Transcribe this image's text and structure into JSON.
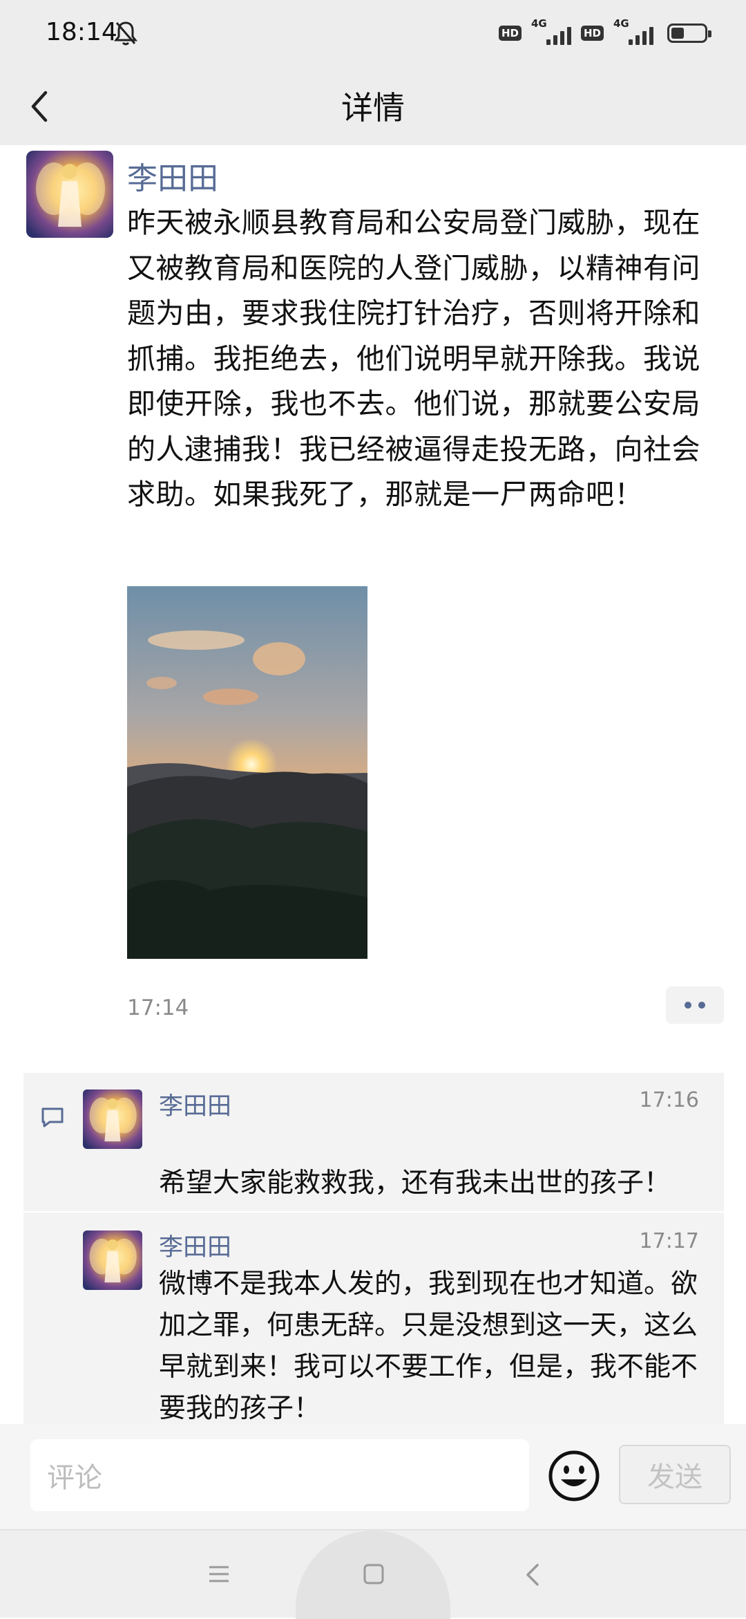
{
  "status_bar": {
    "time": "18:14",
    "hd_label": "HD",
    "network_label": "4G"
  },
  "nav": {
    "title": "详情"
  },
  "post": {
    "author": "李田田",
    "text": "昨天被永顺县教育局和公安局登门威胁，现在又被教育局和医院的人登门威胁，以精神有问题为由，要求我住院打针治疗，否则将开除和抓捕。我拒绝去，他们说明早就开除我。我说即使开除，我也不去。他们说，那就要公安局的人逮捕我！我已经被逼得走投无路，向社会求助。如果我死了，那就是一尸两命吧！",
    "time": "17:14"
  },
  "comments": [
    {
      "author": "李田田",
      "time": "17:16",
      "text": "希望大家能救救我，还有我未出世的孩子！"
    },
    {
      "author": "李田田",
      "time": "17:17",
      "text": "微博不是我本人发的，我到现在也才知道。欲加之罪，何患无辞。只是没想到这一天，这么早就到来！我可以不要工作，但是，我不能不要我的孩子！"
    }
  ],
  "input": {
    "placeholder": "评论",
    "send_label": "发送"
  },
  "icons": {
    "bell": "bell-off-icon",
    "back": "chevron-left-icon",
    "more": "more-dots-icon",
    "comment": "comment-bubble-icon",
    "emoji": "smiley-icon",
    "menu": "menu-icon",
    "home": "square-home-icon",
    "back_nav": "triangle-back-icon"
  }
}
